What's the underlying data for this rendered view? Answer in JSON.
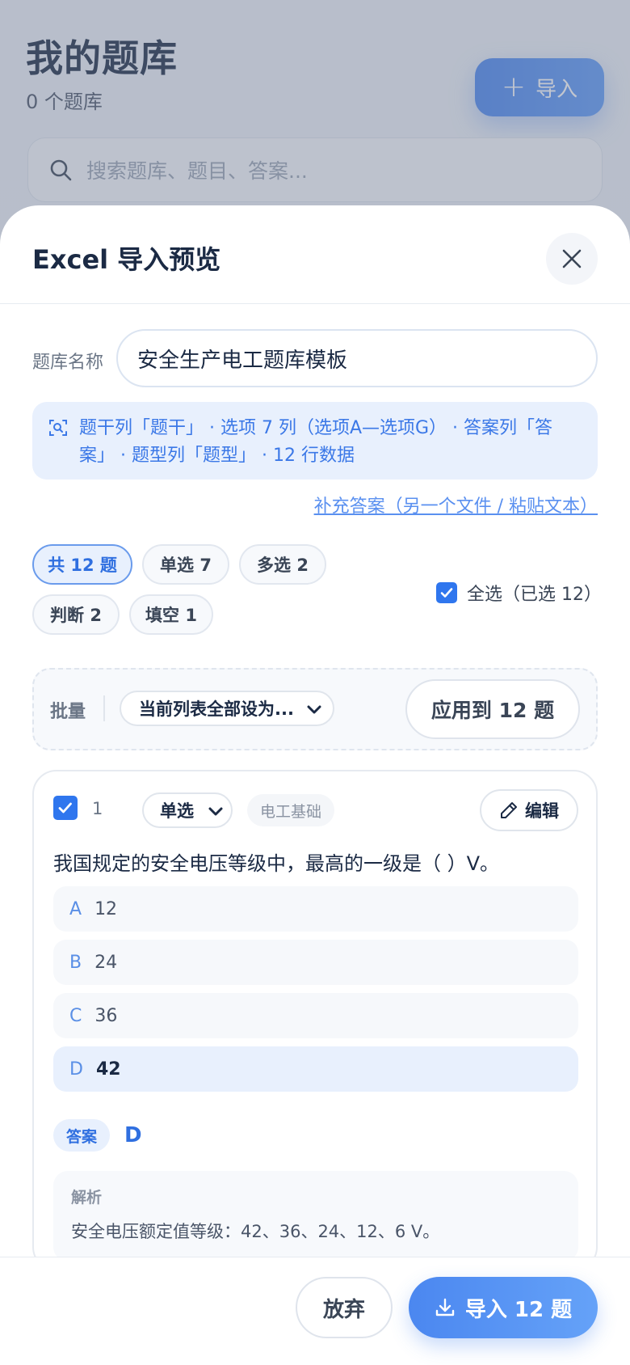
{
  "background": {
    "title": "我的题库",
    "subtitle": "0 个题库",
    "import_label": "导入",
    "search_placeholder": "搜索题库、题目、答案..."
  },
  "sheet": {
    "title": "Excel 导入预览",
    "bank_name_label": "题库名称",
    "bank_name_value": "安全生产电工题库模板",
    "info_line1": "题干列「题干」 · 选项 7 列（选项A—选项G） · 答案列「答",
    "info_line2": "案」 · 题型列「题型」 · 12 行数据",
    "supplement_link": "补充答案（另一个文件 / 粘贴文本）",
    "filters": [
      "共 12 题",
      "单选 7",
      "多选 2",
      "判断 2",
      "填空 1"
    ],
    "select_all_label": "全选（已选 12）",
    "batch": {
      "label": "批量",
      "select_value": "当前列表全部设为...",
      "apply_label": "应用到 12 题"
    }
  },
  "question": {
    "number": "1",
    "type": "单选",
    "category": "电工基础",
    "edit_label": "编辑",
    "text": "我国规定的安全电压等级中，最高的一级是（ ）V。",
    "options": [
      {
        "letter": "A",
        "text": "12"
      },
      {
        "letter": "B",
        "text": "24"
      },
      {
        "letter": "C",
        "text": "36"
      },
      {
        "letter": "D",
        "text": "42"
      }
    ],
    "answer_label": "答案",
    "answer_value": "D",
    "explanation_label": "解析",
    "explanation_text": "安全电压额定值等级：42、36、24、12、6 V。"
  },
  "footer": {
    "discard_label": "放弃",
    "import_label": "导入 12 题"
  },
  "colors": {
    "accent": "#2f76ee",
    "accent_light": "#e8f0fd"
  }
}
